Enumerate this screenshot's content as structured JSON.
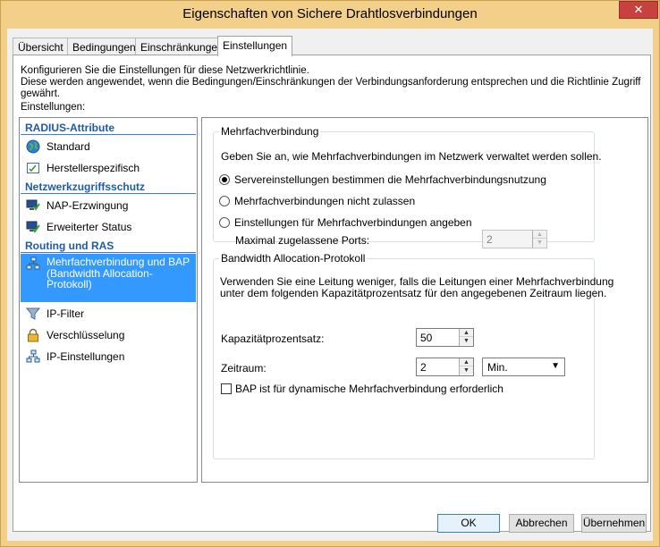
{
  "window": {
    "title": "Eigenschaften von Sichere Drahtlosverbindungen",
    "close_symbol": "✕"
  },
  "tabs": [
    {
      "label": "Übersicht"
    },
    {
      "label": "Bedingungen"
    },
    {
      "label": "Einschränkungen"
    },
    {
      "label": "Einstellungen"
    }
  ],
  "description": {
    "line1": "Konfigurieren Sie die Einstellungen für diese Netzwerkrichtlinie.",
    "line2": "Diese werden angewendet, wenn die Bedingungen/Einschränkungen der Verbindungsanforderung entsprechen und die Richtlinie Zugriff gewährt."
  },
  "settings_label": "Einstellungen:",
  "nav": {
    "sections": [
      {
        "header": "RADIUS-Attribute"
      },
      {
        "header": "Netzwerkzugriffsschutz"
      },
      {
        "header": "Routing und RAS"
      }
    ],
    "items": [
      {
        "label": "Standard",
        "icon": "globe-icon"
      },
      {
        "label": "Herstellerspezifisch",
        "icon": "document-check-icon"
      },
      {
        "label": "NAP-Erzwingung",
        "icon": "nap-computer-icon"
      },
      {
        "label": "Erweiterter Status",
        "icon": "status-check-icon"
      },
      {
        "label": "Mehrfachverbindung und BAP (Bandwidth Allocation-Protokoll)",
        "icon": "network-icon"
      },
      {
        "label": "IP-Filter",
        "icon": "funnel-icon"
      },
      {
        "label": "Verschlüsselung",
        "icon": "lock-icon"
      },
      {
        "label": "IP-Einstellungen",
        "icon": "network-icon"
      }
    ]
  },
  "multilink": {
    "legend": "Mehrfachverbindung",
    "description": "Geben Sie an, wie Mehrfachverbindungen im Netzwerk verwaltet werden sollen.",
    "options": [
      {
        "label": "Servereinstellungen bestimmen die Mehrfachverbindungsnutzung",
        "checked": true
      },
      {
        "label": "Mehrfachverbindungen nicht zulassen",
        "checked": false
      },
      {
        "label": "Einstellungen für Mehrfachverbindungen angeben",
        "checked": false
      }
    ],
    "max_ports_label": "Maximal zugelassene Ports:",
    "max_ports_value": "2"
  },
  "bap": {
    "legend": "Bandwidth Allocation-Protokoll",
    "description_line1": "Verwenden Sie eine Leitung weniger, falls die Leitungen einer Mehrfachverbindung",
    "description_line2": "unter dem folgenden Kapazitätprozentsatz für den angegebenen Zeitraum liegen.",
    "capacity_label": "Kapazitätprozentsatz:",
    "capacity_value": "50",
    "period_label": "Zeitraum:",
    "period_value": "2",
    "period_unit": "Min.",
    "required_label": "BAP ist für dynamische Mehrfachverbindung erforderlich",
    "required_checked": false
  },
  "buttons": {
    "ok": "OK",
    "cancel": "Abbrechen",
    "apply": "Übernehmen"
  },
  "colors": {
    "title_bar": "#f3d08a",
    "close_button": "#c7413f",
    "selection": "#3399ff",
    "section_header": "#1e5aa8"
  }
}
